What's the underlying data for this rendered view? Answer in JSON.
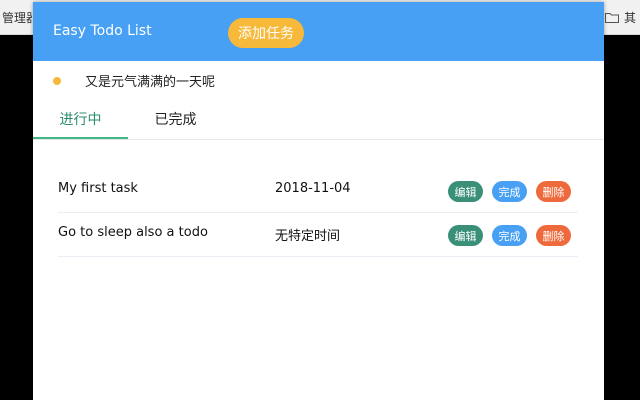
{
  "bookmarks": {
    "left_label": "管理器",
    "right_label": "其"
  },
  "header": {
    "title": "Easy Todo List",
    "add_button": "添加任务"
  },
  "motto": "又是元气满满的一天呢",
  "tabs": [
    {
      "label": "进行中",
      "active": true
    },
    {
      "label": "已完成",
      "active": false
    }
  ],
  "tasks": [
    {
      "name": "My first task",
      "date": "2018-11-04",
      "edit": "编辑",
      "done": "完成",
      "delete": "删除"
    },
    {
      "name": "Go to sleep also a todo",
      "date": "无特定时间",
      "edit": "编辑",
      "done": "完成",
      "delete": "删除"
    }
  ],
  "colors": {
    "header": "#47a0f4",
    "accent_orange": "#f6b93a",
    "edit": "#3a8f78",
    "done": "#47a0f4",
    "delete": "#ee6a3c",
    "tab_active": "#42b983"
  }
}
